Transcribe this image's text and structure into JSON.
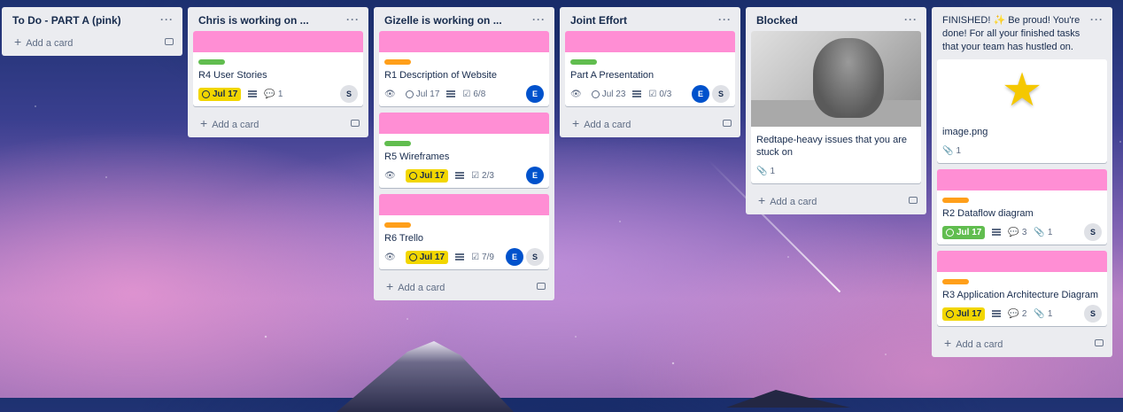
{
  "board": {
    "lists": [
      {
        "title": "To Do - PART A (pink)",
        "add_card": "Add a card"
      },
      {
        "title": "Chris is working on ...",
        "add_card": "Add a card",
        "cards": [
          {
            "title": "R4 User Stories",
            "due": "Jul 17",
            "comments": "1",
            "members": [
              "S"
            ]
          }
        ]
      },
      {
        "title": "Gizelle is working on ...",
        "add_card": "Add a card",
        "cards": [
          {
            "title": "R1 Description of Website",
            "due": "Jul 17",
            "checklist": "6/8",
            "members": [
              "E"
            ]
          },
          {
            "title": "R5 Wireframes",
            "due": "Jul 17",
            "checklist": "2/3",
            "members": [
              "E"
            ]
          },
          {
            "title": "R6 Trello",
            "due": "Jul 17",
            "checklist": "7/9",
            "members": [
              "E",
              "S"
            ]
          }
        ]
      },
      {
        "title": "Joint Effort",
        "add_card": "Add a card",
        "cards": [
          {
            "title": "Part A Presentation",
            "due": "Jul 23",
            "checklist": "0/3",
            "members": [
              "E",
              "S"
            ]
          }
        ]
      },
      {
        "title": "Blocked",
        "add_card": "Add a card",
        "cards": [
          {
            "title": "Redtape-heavy issues that you are stuck on",
            "attachments": "1"
          }
        ]
      },
      {
        "title": "FINISHED! ✨ Be proud! You're done! For all your finished tasks that your team has hustled on.",
        "add_card": "Add a card",
        "cards": [
          {
            "title": "image.png",
            "attachments": "1"
          },
          {
            "title": "R2 Dataflow diagram",
            "due": "Jul 17",
            "comments": "3",
            "attachments": "1",
            "members": [
              "S"
            ]
          },
          {
            "title": "R3 Application Architecture Diagram",
            "due": "Jul 17",
            "comments": "2",
            "attachments": "1",
            "members": [
              "S"
            ]
          }
        ]
      }
    ]
  },
  "colors": {
    "cover_pink": "#ff8ed4",
    "label_green": "#61bd4f",
    "label_orange": "#ff9f1a",
    "due_yellow": "#f2d600",
    "due_green": "#61bd4f",
    "member_e": "#0052cc"
  },
  "menu_glyph": "···"
}
